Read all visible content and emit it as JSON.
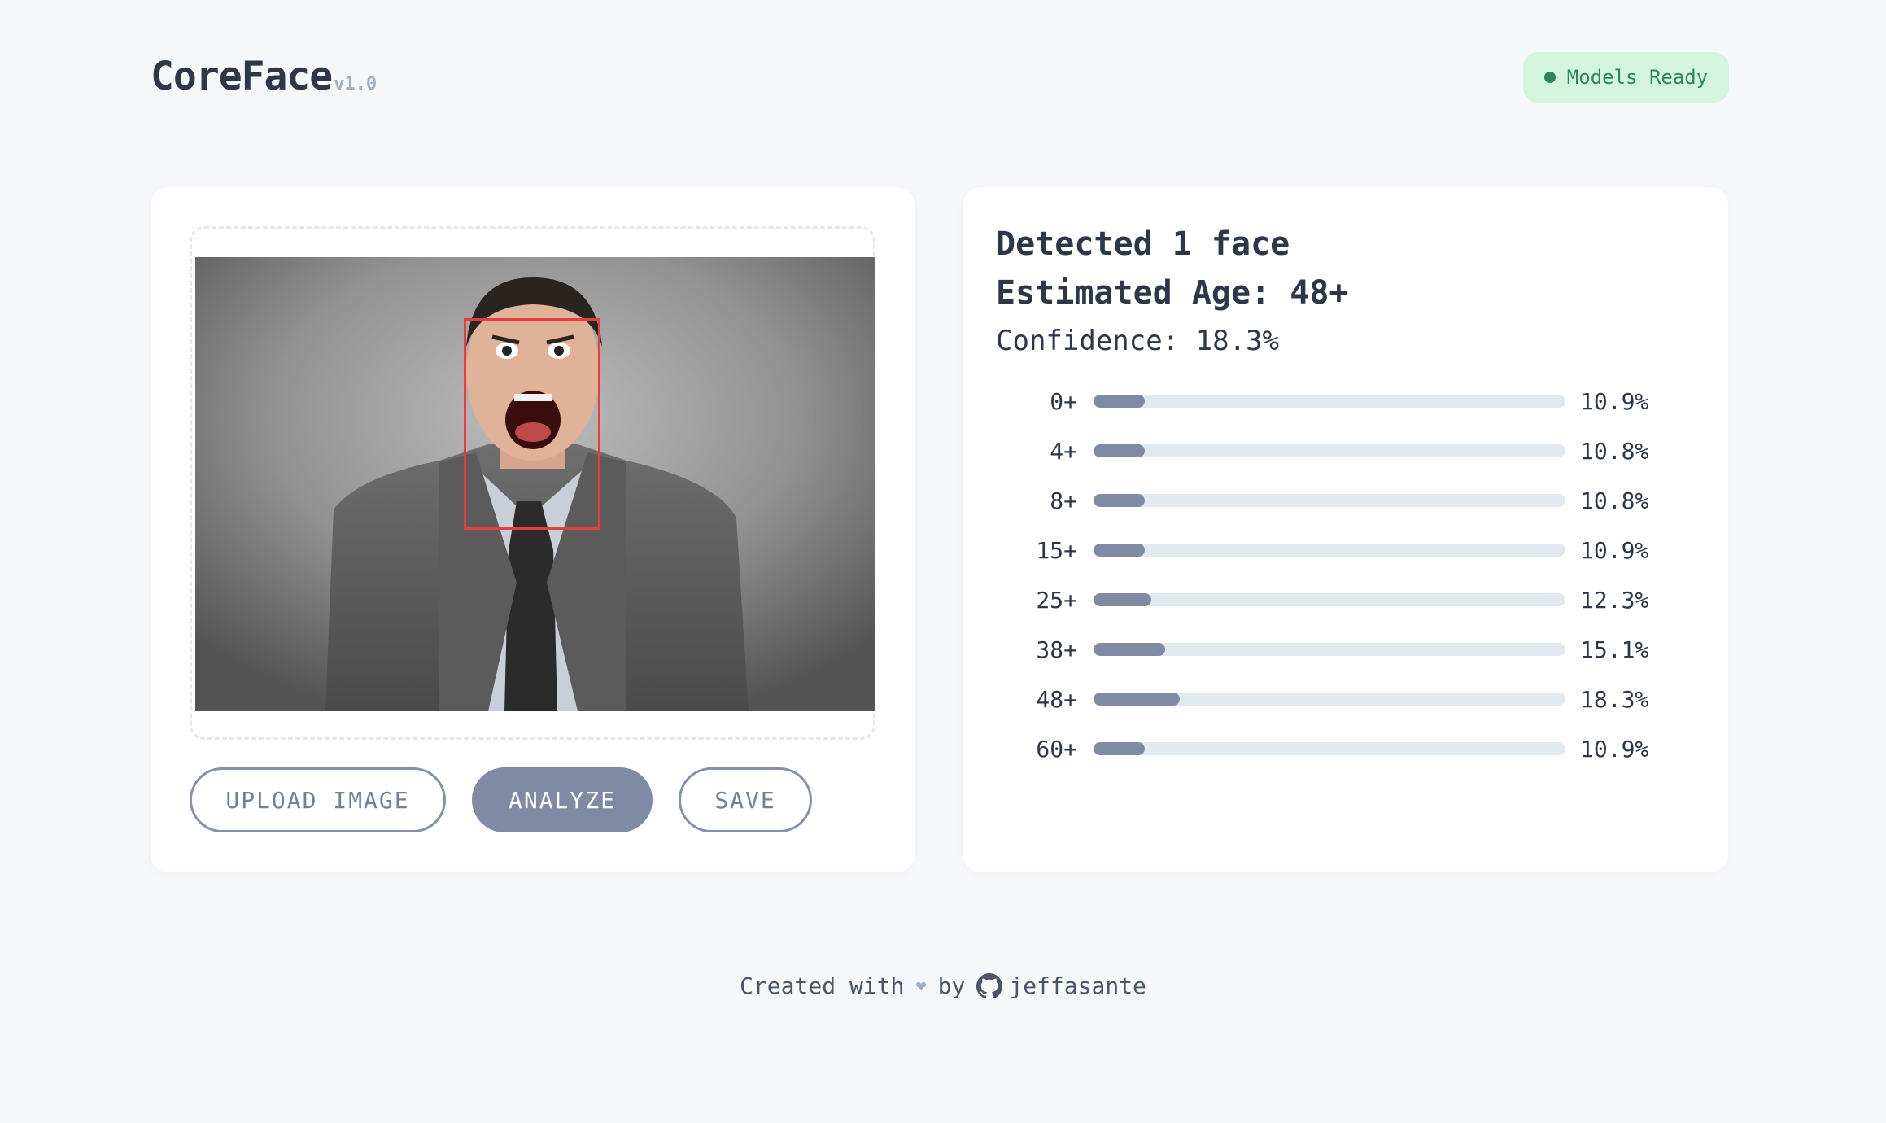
{
  "header": {
    "title": "CoreFace",
    "version": "v1.0",
    "status_label": "Models Ready"
  },
  "image_panel": {
    "buttons": {
      "upload": "UPLOAD IMAGE",
      "analyze": "ANALYZE",
      "save": "SAVE"
    }
  },
  "results": {
    "detected": "Detected 1 face",
    "age": "Estimated Age: 48+",
    "confidence": "Confidence: 18.3%",
    "bars": [
      {
        "label": "0+",
        "value_text": "10.9%",
        "value": 10.9
      },
      {
        "label": "4+",
        "value_text": "10.8%",
        "value": 10.8
      },
      {
        "label": "8+",
        "value_text": "10.8%",
        "value": 10.8
      },
      {
        "label": "15+",
        "value_text": "10.9%",
        "value": 10.9
      },
      {
        "label": "25+",
        "value_text": "12.3%",
        "value": 12.3
      },
      {
        "label": "38+",
        "value_text": "15.1%",
        "value": 15.1
      },
      {
        "label": "48+",
        "value_text": "18.3%",
        "value": 18.3
      },
      {
        "label": "60+",
        "value_text": "10.9%",
        "value": 10.9
      }
    ]
  },
  "footer": {
    "created_with": "Created with",
    "by": "by",
    "author": "jeffasante"
  },
  "colors": {
    "accent": "#7f8ba4",
    "status_bg": "#d4f5dd",
    "status_fg": "#2f855a",
    "face_box": "#e53e3e"
  },
  "icons": [
    "status-dot-icon",
    "heart-icon",
    "github-icon"
  ]
}
